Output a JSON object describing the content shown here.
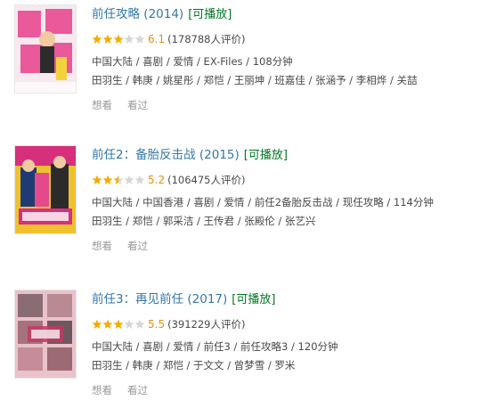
{
  "results": [
    {
      "title": "前任攻略",
      "year": "(2014)",
      "playable": "[可播放]",
      "rating_value": 3,
      "rating": "6.1",
      "rating_count": "(178788人评价)",
      "meta": "中国大陆 / 喜剧 / 爱情 / EX-Files / 108分钟",
      "cast": "田羽生 / 韩庚 / 姚星彤 / 郑恺 / 王丽坤 / 班嘉佳 / 张涵予 / 李相烨 / 关喆",
      "actions": [
        "想看",
        "看过"
      ],
      "poster_bg": "#f7e9ef",
      "poster_accent": "#e83f8a"
    },
    {
      "title": "前任2：备胎反击战",
      "year": "(2015)",
      "playable": "[可播放]",
      "rating_value": 2.5,
      "rating": "5.2",
      "rating_count": "(106475人评价)",
      "meta": "中国大陆 / 中国香港 / 喜剧 / 爱情 / 前任2备胎反击战 / 现任攻略 / 114分钟",
      "cast": "田羽生 / 郑恺 / 郭采洁 / 王传君 / 张殿伦 / 张艺兴",
      "actions": [
        "想看",
        "看过"
      ],
      "poster_bg": "#f0c12e",
      "poster_accent": "#d62f7c"
    },
    {
      "title": "前任3：再见前任",
      "year": "(2017)",
      "playable": "[可播放]",
      "rating_value": 3,
      "rating": "5.5",
      "rating_count": "(391229人评价)",
      "meta": "中国大陆 / 喜剧 / 爱情 / 前任3 / 前任攻略3 / 120分钟",
      "cast": "田羽生 / 韩庚 / 郑恺 / 于文文 / 曾梦雪 / 罗米",
      "actions": [
        "想看",
        "看过"
      ],
      "poster_bg": "#e9c2cb",
      "poster_accent": "#c23a64"
    }
  ],
  "colors": {
    "title": "#3377aa",
    "playable": "#007722",
    "rating": "#e09015",
    "star_on": "#f6ab00",
    "star_off": "#d6d6d6",
    "muted": "#999999"
  }
}
